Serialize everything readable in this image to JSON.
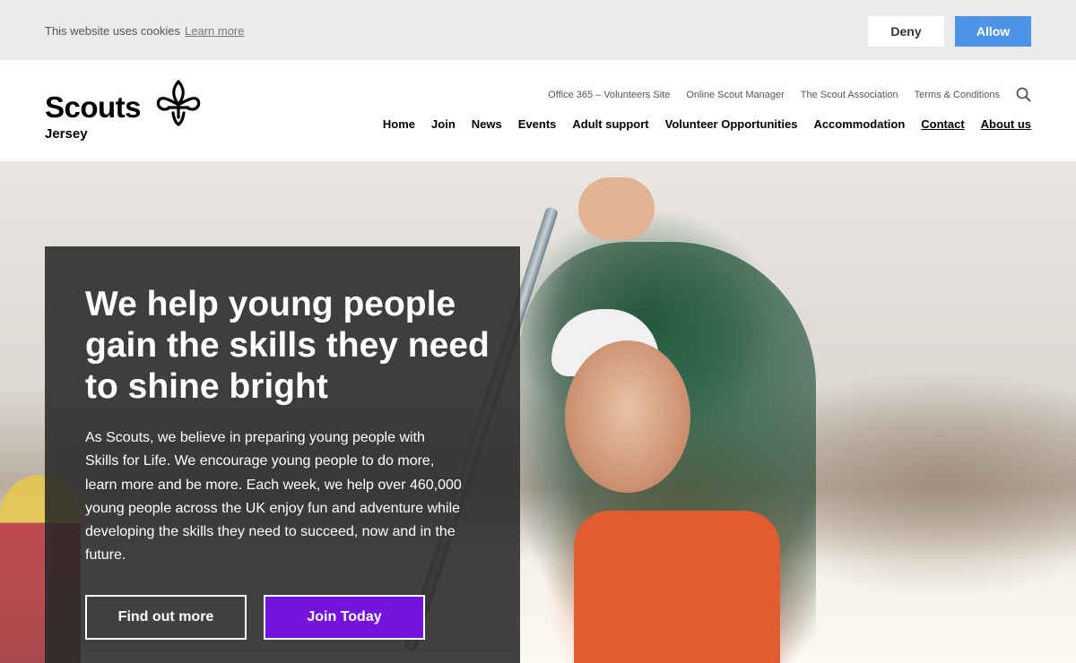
{
  "cookie_banner": {
    "message": "This website uses cookies",
    "learn_more": "Learn more",
    "deny_label": "Deny",
    "allow_label": "Allow"
  },
  "header": {
    "logo_text": "Scouts",
    "logo_subtext": "Jersey",
    "utility_links": [
      "Office 365 – Volunteers Site",
      "Online Scout Manager",
      "The Scout Association",
      "Terms & Conditions"
    ],
    "main_nav": [
      "Home",
      "Join",
      "News",
      "Events",
      "Adult support",
      "Volunteer Opportunities",
      "Accommodation",
      "Contact",
      "About us"
    ]
  },
  "hero": {
    "title": "We help young people gain the skills they need to shine bright",
    "body": "As Scouts, we believe in preparing young people with Skills for Life. We encourage young people to do more, learn more and be more. Each week, we help over 460,000 young people across the UK enjoy fun and adventure while developing the skills they need to succeed, now and in the future.",
    "find_out_more": "Find out more",
    "join_today": "Join Today"
  },
  "colors": {
    "allow_button": "#4d94e8",
    "join_button": "#7413dc",
    "panel": "#282828"
  },
  "icons": {
    "search": "search-icon",
    "logo": "fleur-de-lis-icon"
  }
}
